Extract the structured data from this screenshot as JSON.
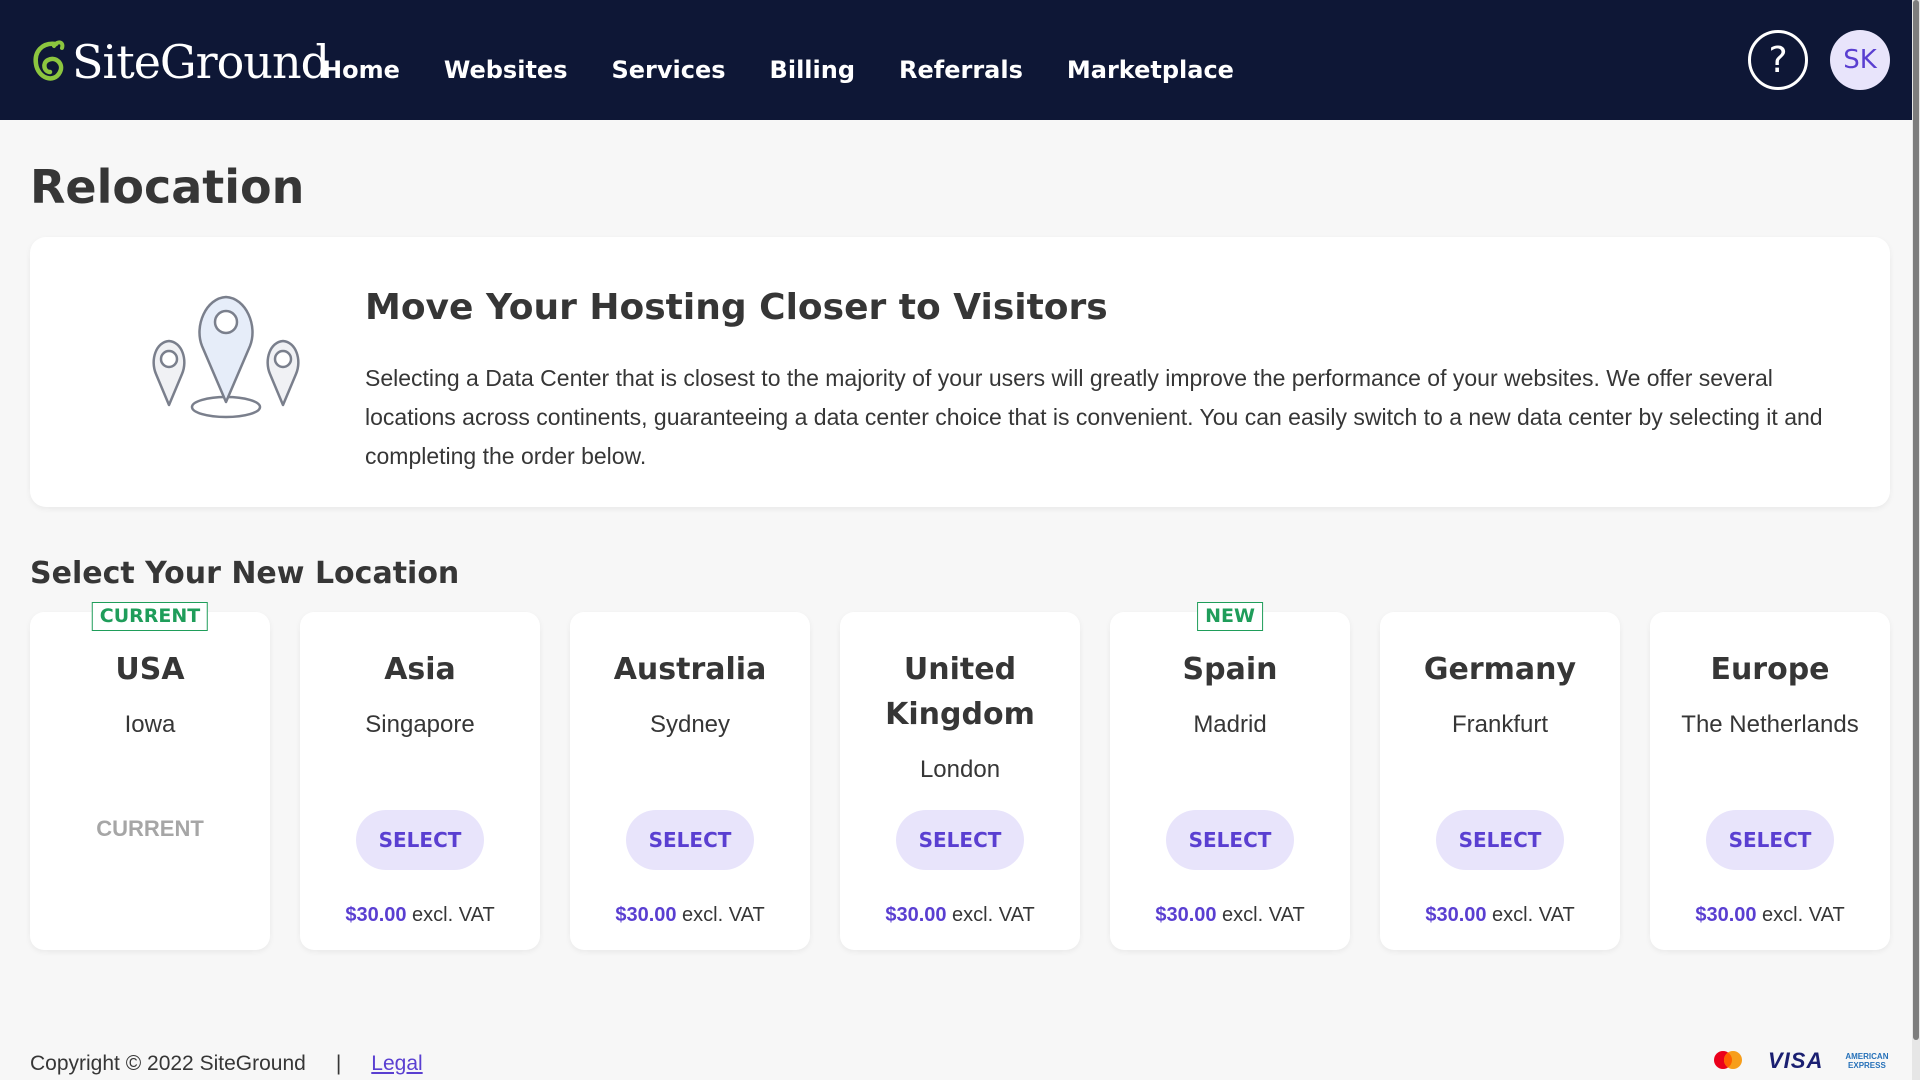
{
  "header": {
    "logo_text": "SiteGround",
    "nav": [
      {
        "label": "Home"
      },
      {
        "label": "Websites"
      },
      {
        "label": "Services"
      },
      {
        "label": "Billing"
      },
      {
        "label": "Referrals"
      },
      {
        "label": "Marketplace"
      }
    ],
    "help_icon": "question-circle-icon",
    "help_label": "?",
    "avatar_initials": "SK"
  },
  "page": {
    "title": "Relocation"
  },
  "info_card": {
    "icon": "map-pins-icon",
    "title": "Move Your Hosting Closer to Visitors",
    "description": "Selecting a Data Center that is closest to the majority of your users will greatly improve the performance of your websites. We offer several locations across continents, guaranteeing a data center choice that is convenient. You can easily switch to a new data center by selecting it and completing the order below."
  },
  "locations_section": {
    "title": "Select Your New Location",
    "items": [
      {
        "badge": "CURRENT",
        "name": "USA",
        "city": "Iowa",
        "status": "CURRENT",
        "select_label": "",
        "price": "",
        "price_suffix": ""
      },
      {
        "badge": "",
        "name": "Asia",
        "city": "Singapore",
        "status": "",
        "select_label": "SELECT",
        "price": "$30.00",
        "price_suffix": " excl. VAT"
      },
      {
        "badge": "",
        "name": "Australia",
        "city": "Sydney",
        "status": "",
        "select_label": "SELECT",
        "price": "$30.00",
        "price_suffix": " excl. VAT"
      },
      {
        "badge": "",
        "name": "United Kingdom",
        "city": "London",
        "status": "",
        "select_label": "SELECT",
        "price": "$30.00",
        "price_suffix": " excl. VAT"
      },
      {
        "badge": "NEW",
        "name": "Spain",
        "city": "Madrid",
        "status": "",
        "select_label": "SELECT",
        "price": "$30.00",
        "price_suffix": " excl. VAT"
      },
      {
        "badge": "",
        "name": "Germany",
        "city": "Frankfurt",
        "status": "",
        "select_label": "SELECT",
        "price": "$30.00",
        "price_suffix": " excl. VAT"
      },
      {
        "badge": "",
        "name": "Europe",
        "city": "The Netherlands",
        "status": "",
        "select_label": "SELECT",
        "price": "$30.00",
        "price_suffix": " excl. VAT"
      }
    ]
  },
  "footer": {
    "copyright": "Copyright © 2022 SiteGround",
    "separator": "|",
    "legal_link": "Legal",
    "payment_icons": [
      "mastercard-icon",
      "visa-icon",
      "american-express-icon"
    ],
    "visa_label": "VISA",
    "amex_label_1": "AMERICAN",
    "amex_label_2": "EXPRESS"
  },
  "colors": {
    "header_bg": "#0e1736",
    "accent": "#5a3fd1",
    "accent_light": "#e8e4fb",
    "badge_green": "#1f9d5a",
    "page_bg": "#f7f7f7"
  }
}
